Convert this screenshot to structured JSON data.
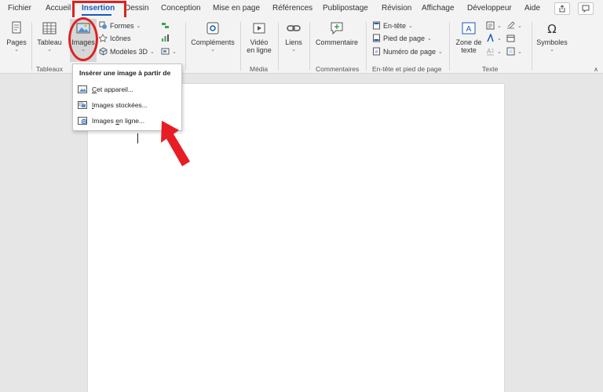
{
  "menu": {
    "tabs": [
      {
        "label": "Fichier"
      },
      {
        "label": "Accueil"
      },
      {
        "label": "Insertion",
        "active": true
      },
      {
        "label": "Dessin"
      },
      {
        "label": "Conception"
      },
      {
        "label": "Mise en page"
      },
      {
        "label": "Références"
      },
      {
        "label": "Publipostage"
      },
      {
        "label": "Révision"
      },
      {
        "label": "Affichage"
      },
      {
        "label": "Développeur"
      },
      {
        "label": "Aide"
      }
    ]
  },
  "ribbon": {
    "pages": {
      "label": "Pages"
    },
    "tableau": {
      "label": "Tableau"
    },
    "images": {
      "label": "Images"
    },
    "formes": {
      "label": "Formes"
    },
    "icones": {
      "label": "Icônes"
    },
    "modeles3d": {
      "label": "Modèles 3D"
    },
    "complements": {
      "label": "Compléments"
    },
    "video": {
      "line1": "Vidéo",
      "line2": "en ligne"
    },
    "liens": {
      "label": "Liens"
    },
    "commentaire": {
      "label": "Commentaire"
    },
    "entete": {
      "label": "En-tête"
    },
    "pied": {
      "label": "Pied de page"
    },
    "numero": {
      "label": "Numéro de page"
    },
    "zone_texte": {
      "line1": "Zone de",
      "line2": "texte"
    },
    "symboles": {
      "label": "Symboles"
    },
    "groups": {
      "tableaux": "Tableaux",
      "media": "Média",
      "commentaires": "Commentaires",
      "entete_pied": "En-tête et pied de page",
      "texte": "Texte"
    }
  },
  "dropdown": {
    "header": "Insérer une image à partir de",
    "items": [
      {
        "pre": "",
        "ul": "C",
        "post": "et appareil..."
      },
      {
        "pre": "",
        "ul": "I",
        "post": "mages stockées..."
      },
      {
        "pre": "Images ",
        "ul": "e",
        "post": "n ligne..."
      }
    ]
  },
  "colors": {
    "accent": "#185abd",
    "highlight": "#e02020",
    "ribbon_bg": "#f3f3f3",
    "doc_bg": "#e6e6e6"
  },
  "icons": [
    "pages-icon",
    "table-icon",
    "images-icon",
    "shapes-icon",
    "icons-icon",
    "3d-models-icon",
    "addins-icon",
    "video-icon",
    "link-icon",
    "comment-icon",
    "header-icon",
    "footer-icon",
    "page-number-icon",
    "textbox-icon",
    "omega-icon",
    "share-icon",
    "comments-icon",
    "camera-icon",
    "stock-images-icon",
    "online-images-icon"
  ]
}
